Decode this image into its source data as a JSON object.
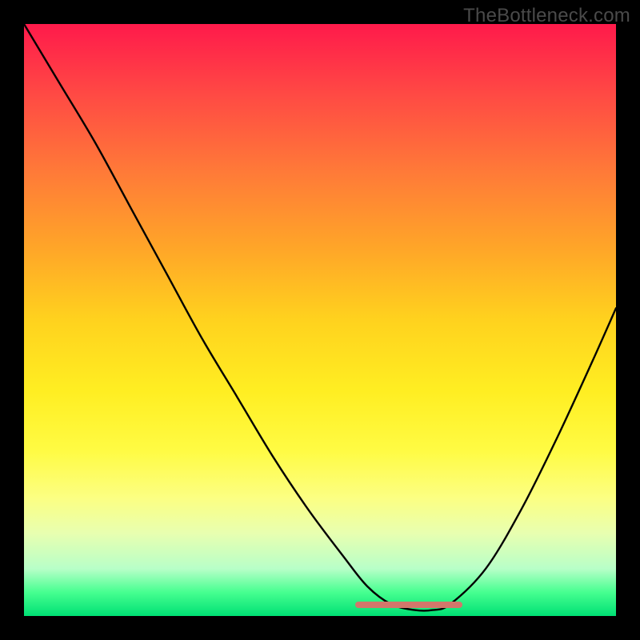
{
  "watermark": "TheBottleneck.com",
  "chart_data": {
    "type": "line",
    "title": "",
    "xlabel": "",
    "ylabel": "",
    "xlim": [
      0,
      100
    ],
    "ylim": [
      0,
      100
    ],
    "background_gradient": {
      "top_color": "#ff1a4b",
      "bottom_color": "#00e074",
      "meaning": "high value = bad (red), low value = good (green)"
    },
    "series": [
      {
        "name": "bottleneck-curve",
        "x": [
          0,
          6,
          12,
          18,
          24,
          30,
          36,
          42,
          48,
          54,
          58,
          62,
          66,
          69,
          72,
          78,
          84,
          90,
          96,
          100
        ],
        "values": [
          100,
          90,
          80,
          69,
          58,
          47,
          37,
          27,
          18,
          10,
          5,
          2,
          1,
          1,
          2,
          8,
          18,
          30,
          43,
          52
        ]
      }
    ],
    "annotations": [
      {
        "name": "optimal-range-bar",
        "type": "hspan",
        "x_start": 56,
        "x_end": 74,
        "y": 1,
        "color": "#d2776b"
      }
    ]
  }
}
